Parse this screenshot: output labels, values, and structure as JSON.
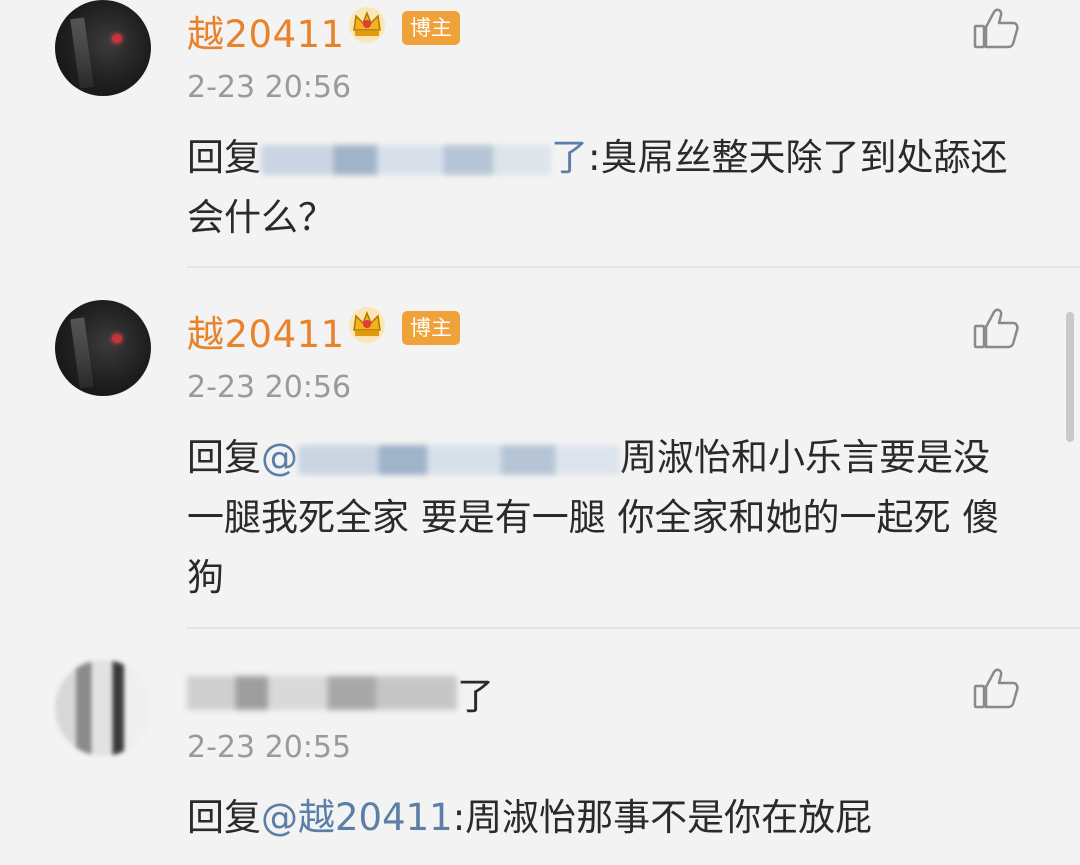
{
  "comments": [
    {
      "name": "越20411",
      "badge": "博主",
      "time": "2-23 20:56",
      "reply_prefix": "回复",
      "reply_mention_tail": "了",
      "reply_separator": ":",
      "body": "臭屌丝整天除了到处舔还会什么？"
    },
    {
      "name": "越20411",
      "badge": "博主",
      "time": "2-23 20:56",
      "reply_prefix": "回复",
      "reply_mention_head": "@",
      "body": "周淑怡和小乐言要是没一腿我死全家 要是有一腿 你全家和她的一起死 傻狗"
    },
    {
      "name_tail": "了",
      "time": "2-23 20:55",
      "reply_prefix": "回复",
      "reply_mention": "@越20411",
      "reply_separator": ":",
      "body": "周淑怡那事不是你在放屁"
    }
  ],
  "colors": {
    "username": "#e9832b",
    "badge": "#f0a23a",
    "mention": "#5b7fa6",
    "timestamp": "#9a9a9a",
    "background": "#f3f3f3"
  },
  "icons": {
    "like": "thumbs-up-icon",
    "crown": "crown-icon"
  }
}
